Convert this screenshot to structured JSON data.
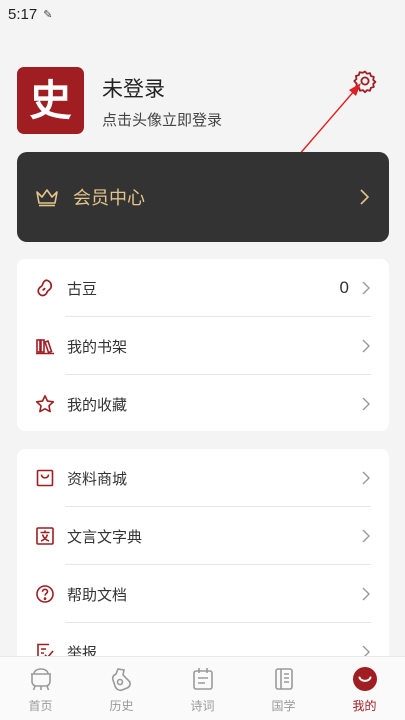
{
  "status_bar": {
    "time": "5:17",
    "extra_icon": "pen-icon"
  },
  "profile": {
    "avatar_char": "史",
    "name": "未登录",
    "hint": "点击头像立即登录",
    "settings_icon": "gear-icon"
  },
  "vip": {
    "label": "会员中心",
    "icon": "crown-icon"
  },
  "menu_group_1": [
    {
      "label": "古豆",
      "value": "0",
      "icon": "bean-icon"
    },
    {
      "label": "我的书架",
      "icon": "bookshelf-icon"
    },
    {
      "label": "我的收藏",
      "icon": "star-icon"
    }
  ],
  "menu_group_2": [
    {
      "label": "资料商城",
      "icon": "shop-bag-icon"
    },
    {
      "label": "文言文字典",
      "icon": "dictionary-icon"
    },
    {
      "label": "帮助文档",
      "icon": "help-icon"
    },
    {
      "label": "举报",
      "icon": "report-icon"
    }
  ],
  "tabbar": [
    {
      "label": "首页",
      "icon": "cauldron-icon"
    },
    {
      "label": "历史",
      "icon": "history-icon"
    },
    {
      "label": "诗词",
      "icon": "calendar-icon"
    },
    {
      "label": "国学",
      "icon": "scroll-book-icon"
    },
    {
      "label": "我的",
      "icon": "profile-face-icon",
      "active": true
    }
  ],
  "colors": {
    "accent": "#a01d22",
    "vip_bg": "#333333",
    "vip_text": "#e3c48a",
    "background": "#f4f4f4"
  }
}
